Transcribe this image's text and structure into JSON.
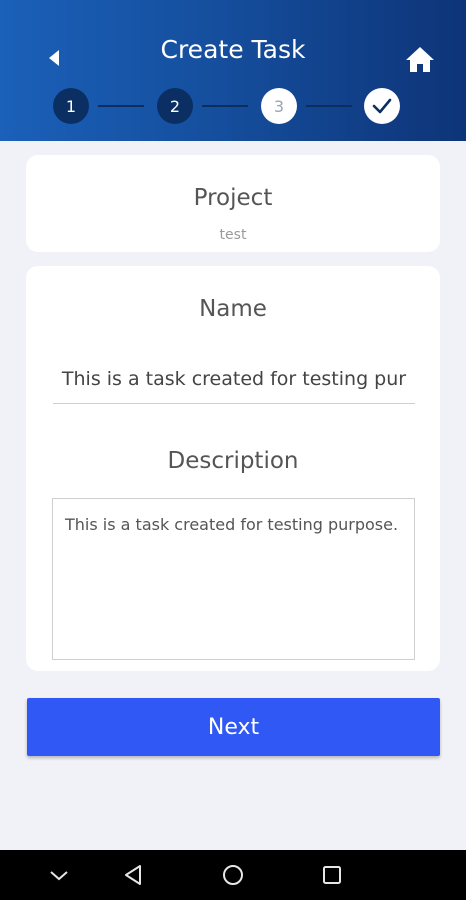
{
  "header": {
    "title": "Create Task",
    "back_icon": "back-arrow-icon",
    "home_icon": "home-icon",
    "background_colors": [
      "#1b60b9",
      "#0e3478"
    ]
  },
  "stepper": {
    "steps": [
      {
        "label": "1",
        "state": "done"
      },
      {
        "label": "2",
        "state": "done"
      },
      {
        "label": "3",
        "state": "current"
      },
      {
        "label": "",
        "state": "final",
        "icon": "checkmark-icon"
      }
    ]
  },
  "project": {
    "label": "Project",
    "value": "test"
  },
  "form": {
    "name_label": "Name",
    "name_value": "This is a task created for testing pur",
    "description_label": "Description",
    "description_value": "This is a task created for testing purpose."
  },
  "actions": {
    "next_label": "Next",
    "accent_color": "#2f58f5"
  },
  "system_nav": {
    "icons": [
      "chevron-down-icon",
      "back-triangle-icon",
      "home-circle-icon",
      "recents-square-icon"
    ]
  }
}
